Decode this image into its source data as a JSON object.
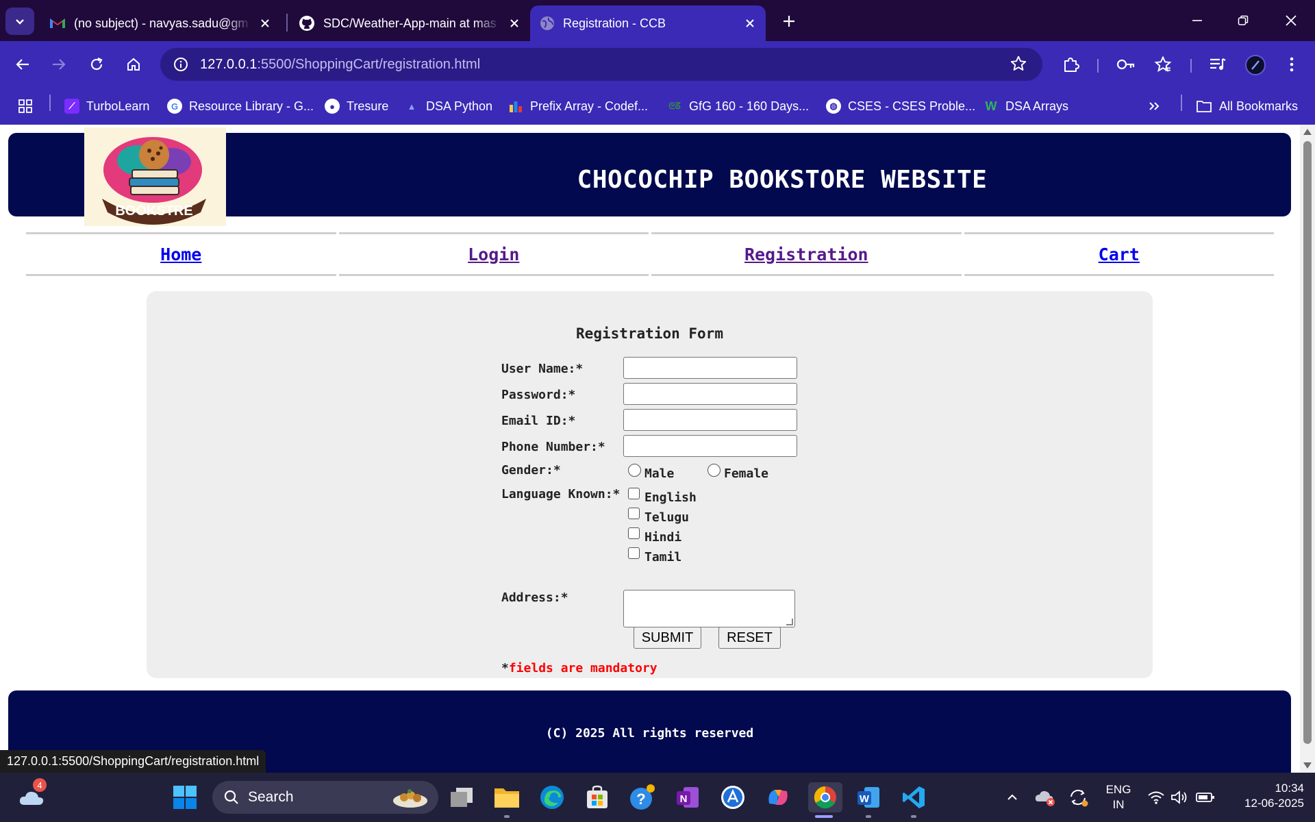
{
  "browser": {
    "tabs": [
      {
        "title": "(no subject) - navyas.sadu@gm",
        "icon": "gmail-icon"
      },
      {
        "title": "SDC/Weather-App-main at mas",
        "icon": "github-icon"
      },
      {
        "title": "Registration - CCB",
        "icon": "globe-icon",
        "active": true
      }
    ],
    "url_host": "127.0.0.1",
    "url_path": ":5500/ShoppingCart/registration.html",
    "bookmarks": [
      {
        "label": "TurboLearn",
        "icon": "turbolearn-icon",
        "color": "#7b2cff"
      },
      {
        "label": "Resource Library - G...",
        "icon": "google-icon",
        "color": "#ffffff"
      },
      {
        "label": "Tresure",
        "icon": "github-icon",
        "color": "#ffffff"
      },
      {
        "label": "DSA Python",
        "icon": "dsa-icon",
        "color": "#5865f2"
      },
      {
        "label": "Prefix Array - Codef...",
        "icon": "codeforces-icon",
        "color": "#f7c948"
      },
      {
        "label": "GfG 160 - 160 Days...",
        "icon": "gfg-icon",
        "color": "#2f8d46"
      },
      {
        "label": "CSES - CSES Proble...",
        "icon": "globe-icon",
        "color": "#ffffff"
      },
      {
        "label": "DSA Arrays",
        "icon": "w-icon",
        "color": "#2f8d46"
      }
    ],
    "all_bookmarks": "All Bookmarks",
    "status_url": "127.0.0.1:5500/ShoppingCart/registration.html"
  },
  "site": {
    "title": "CHOCOCHIP BOOKSTORE WEBSITE",
    "logo_text": "BOOKSTRE",
    "nav": [
      "Home",
      "Login",
      "Registration",
      "Cart"
    ],
    "footer": "(C) 2025 All rights reserved"
  },
  "form": {
    "title": "Registration Form",
    "username_label": "User Name:*",
    "password_label": "Password:*",
    "email_label": "Email ID:*",
    "phone_label": "Phone Number:*",
    "gender_label": "Gender:*",
    "gender_options": [
      "Male",
      "Female"
    ],
    "language_label": "Language Known:*",
    "languages": [
      "English",
      "Telugu",
      "Hindi",
      "Tamil"
    ],
    "address_label": "Address:*",
    "submit": "SUBMIT",
    "reset": "RESET",
    "mandatory_asterisk": "*",
    "mandatory_text": "fields are mandatory"
  },
  "taskbar": {
    "weather_badge": "4",
    "search_placeholder": "Search",
    "lang_line1": "ENG",
    "lang_line2": "IN",
    "time": "10:34",
    "date": "12-06-2025"
  },
  "colors": {
    "chrome_frame": "#200a3c",
    "chrome_toolbar": "#3a2ab6",
    "site_header": "#02094e",
    "mandatory_red": "#ff0000",
    "link_blue": "#0000ee",
    "link_visited": "#551a8b"
  }
}
